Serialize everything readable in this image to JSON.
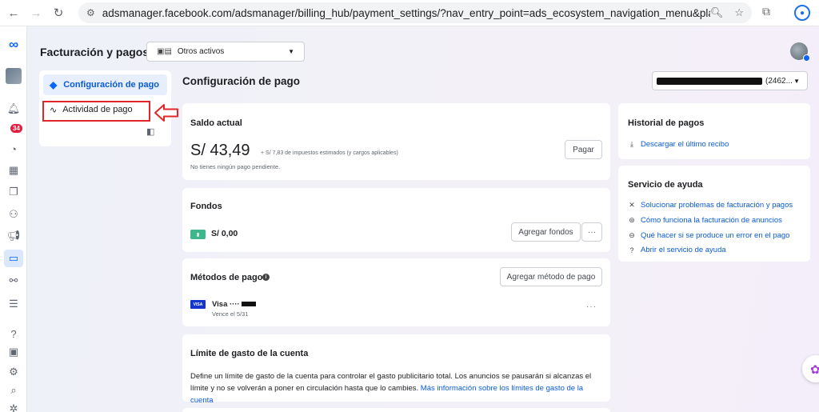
{
  "browser": {
    "url": "adsmanager.facebook.com/adsmanager/billing_hub/payment_settings/?nav_entry_point=ads_ecosystem_navigation_menu&placement=ads_ma..."
  },
  "rail": {
    "notification_count": "34"
  },
  "header": {
    "title": "Facturación y pagos",
    "assets_select": "Otros activos"
  },
  "menu": {
    "items": [
      {
        "label": "Configuración de pago"
      },
      {
        "label": "Actividad de pago"
      }
    ]
  },
  "main": {
    "section_title": "Configuración de pago",
    "account_suffix": "(2462..."
  },
  "saldo": {
    "title": "Saldo actual",
    "amount": "S/ 43,49",
    "tax_note": "+ S/ 7,83 de impuestos estimados (y cargos aplicables)",
    "pending": "No tienes ningún pago pendiente.",
    "pay_button": "Pagar"
  },
  "fondos": {
    "title": "Fondos",
    "balance": "S/ 0,00",
    "add_button": "Agregar fondos",
    "more": "···"
  },
  "metodos": {
    "title": "Métodos de pago",
    "add_button": "Agregar método de pago",
    "card_brand": "VISA",
    "card_name": "Visa ····",
    "expiry": "Vence el 5/31",
    "more": "···"
  },
  "limite": {
    "title": "Límite de gasto de la cuenta",
    "description": "Define un límite de gasto de la cuenta para controlar el gasto publicitario total. Los anuncios se pausarán si alcanzas el límite y no se volverán a poner en circulación hasta que lo cambies.",
    "link": "Más información sobre los límites de gasto de la cuenta"
  },
  "historial": {
    "title": "Historial de pagos",
    "download": "Descargar el último recibo"
  },
  "ayuda": {
    "title": "Servicio de ayuda",
    "links": [
      "Solucionar problemas de facturación y pagos",
      "Cómo funciona la facturación de anuncios",
      "Qué hacer si se produce un error en el pago",
      "Abrir el servicio de ayuda"
    ]
  },
  "colors": {
    "accent": "#0866ff",
    "link": "#0a5bd6",
    "highlight": "#e3262a",
    "wallet": "#3fb68b"
  }
}
